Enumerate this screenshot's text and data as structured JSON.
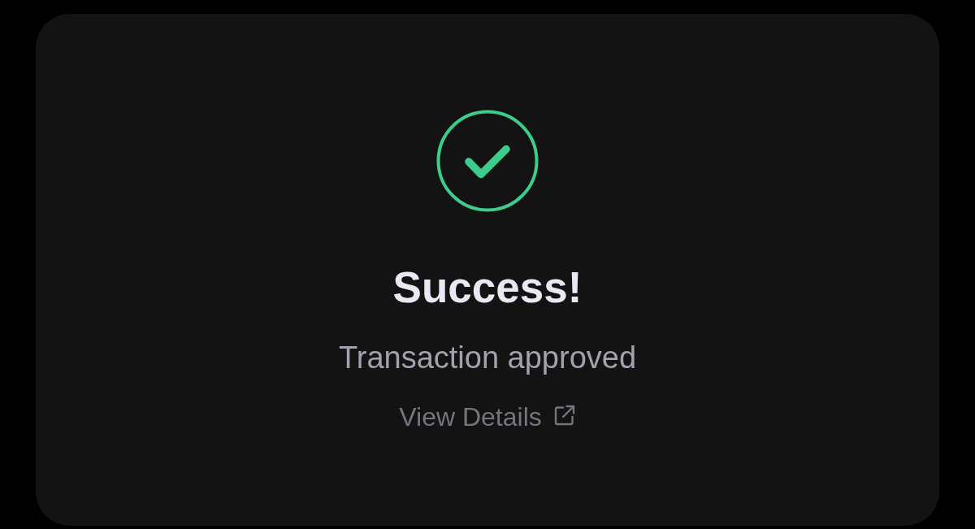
{
  "card": {
    "kind": "success",
    "title": "Success!",
    "message": "Transaction approved",
    "link": {
      "label": "View Details",
      "external": true
    }
  }
}
